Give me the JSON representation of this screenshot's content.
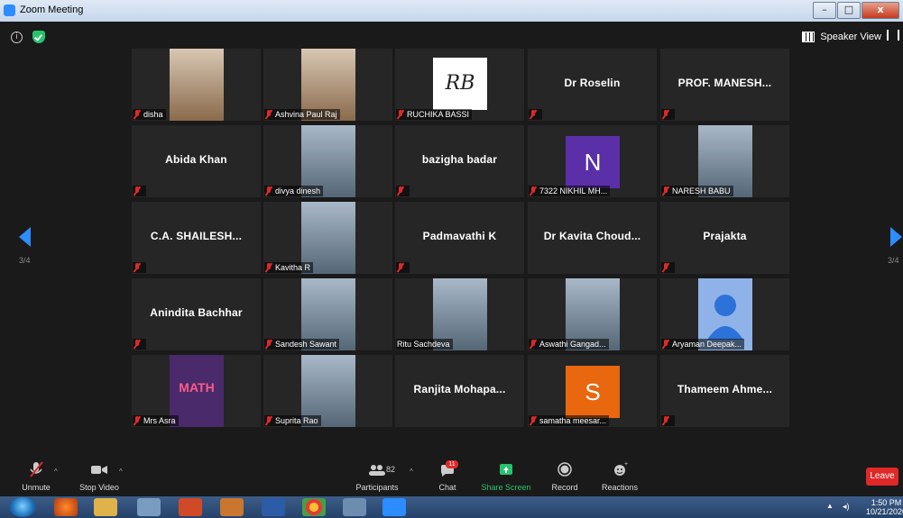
{
  "window": {
    "title": "Zoom Meeting",
    "minimize": "–",
    "maximize": "□",
    "close": "x"
  },
  "topbar": {
    "speaker_view": "Speaker View"
  },
  "pager": {
    "left": "3/4",
    "right": "3/4"
  },
  "tiles": [
    {
      "name": "disha",
      "type": "video",
      "muted": true
    },
    {
      "name": "Ashvina Paul Raj",
      "type": "video",
      "muted": true
    },
    {
      "name": "RUCHIKA BASSI",
      "type": "image",
      "muted": true,
      "logo_text": "RB"
    },
    {
      "name": "Dr Roselin",
      "type": "name",
      "muted": true
    },
    {
      "name": "PROF.  MANESH...",
      "type": "name",
      "muted": true
    },
    {
      "name": "Abida Khan",
      "type": "name",
      "muted": true
    },
    {
      "name": "divya dinesh",
      "type": "image",
      "muted": true
    },
    {
      "name": "bazigha badar",
      "type": "name",
      "muted": true
    },
    {
      "name": "7322 NIKHIL MH...",
      "type": "letter",
      "letter": "N",
      "letter_color": "#5b2fa8",
      "muted": true
    },
    {
      "name": "NARESH BABU",
      "type": "image",
      "muted": true
    },
    {
      "name": "C.A.  SHAILESH...",
      "type": "name",
      "muted": true
    },
    {
      "name": "Kavitha R",
      "type": "image",
      "muted": true
    },
    {
      "name": "Padmavathi K",
      "type": "name",
      "muted": true
    },
    {
      "name": "Dr Kavita  Choud...",
      "type": "name",
      "muted": false
    },
    {
      "name": "Prajakta",
      "type": "name",
      "muted": true
    },
    {
      "name": "Anindita Bachhar",
      "type": "name",
      "muted": true
    },
    {
      "name": "Sandesh Sawant",
      "type": "image",
      "muted": true
    },
    {
      "name": "Ritu Sachdeva",
      "type": "image",
      "muted": false
    },
    {
      "name": "Aswathi Gangad...",
      "type": "image",
      "muted": true
    },
    {
      "name": "Aryaman Deepak...",
      "type": "avatar",
      "muted": true
    },
    {
      "name": "Mrs Asra",
      "type": "image",
      "muted": true,
      "image_text": "MATH"
    },
    {
      "name": "Suprita Rao",
      "type": "image",
      "muted": true
    },
    {
      "name": "Ranjita  Mohapa...",
      "type": "name",
      "muted": false
    },
    {
      "name": "samatha meesar...",
      "type": "letter",
      "letter": "S",
      "letter_color": "#e8670f",
      "muted": true
    },
    {
      "name": "Thameem  Ahme...",
      "type": "name",
      "muted": true
    }
  ],
  "toolbar": {
    "unmute": "Unmute",
    "stop_video": "Stop Video",
    "participants": "Participants",
    "participants_count": "82",
    "chat": "Chat",
    "chat_badge": "11",
    "share_screen": "Share Screen",
    "record": "Record",
    "reactions": "Reactions",
    "leave": "Leave"
  },
  "taskbar": {
    "time": "1:50 PM",
    "date": "10/21/2020"
  },
  "colors": {
    "accent": "#2d8cff",
    "leave": "#e02828",
    "share": "#27c36b"
  }
}
